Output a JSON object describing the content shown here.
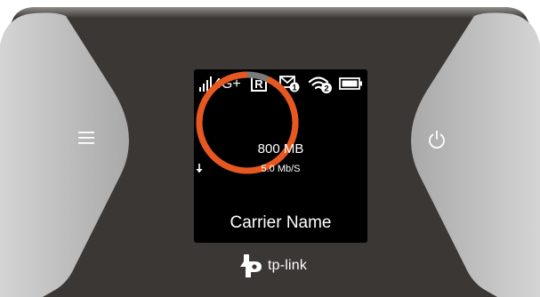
{
  "device": {
    "brand_label": "tp-link",
    "buttons": {
      "menu_icon": "hamburger-menu-icon",
      "power_icon": "power-icon"
    }
  },
  "status_bar": {
    "signal_icon": "signal-bars-icon",
    "network_type": "4G+",
    "roaming_icon": "roaming-r-icon",
    "roaming_letter": "R",
    "messages_icon": "envelope-icon",
    "messages_count": "1",
    "wifi_icon": "wifi-icon",
    "wifi_clients": "2",
    "battery_icon": "battery-icon"
  },
  "screen": {
    "data_usage": "800 MB",
    "speed": "5.0 Mb/S",
    "speed_icon": "download-arrow-icon",
    "carrier_name": "Carrier Name",
    "usage_fraction": 0.93
  },
  "colors": {
    "ring_accent": "#e8571f",
    "ring_track": "#7a7a7a",
    "body_dark": "#3b3735",
    "body_gray": "#b9b9b9"
  }
}
